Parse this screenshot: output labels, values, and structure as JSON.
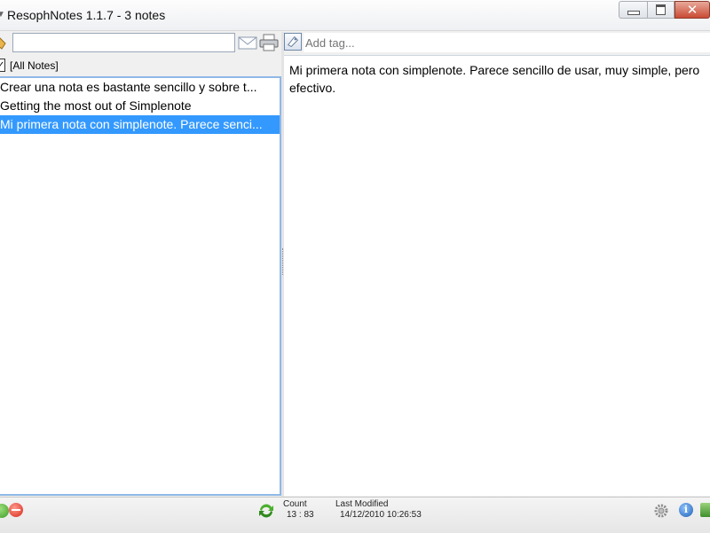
{
  "window": {
    "title": "ResophNotes 1.1.7 - 3 notes",
    "app_icon": "note-icon",
    "controls": [
      "minimize-icon",
      "maximize-icon",
      "close-icon"
    ]
  },
  "left_toolbar": {
    "search_value": "",
    "search_placeholder": "",
    "icons": [
      "tag-search-icon",
      "mail-icon",
      "print-icon"
    ]
  },
  "filter": {
    "label": "[All Notes]"
  },
  "notes": [
    {
      "text": "Crear una nota es bastante sencillo y sobre t..."
    },
    {
      "text": "Getting the most out of Simplenote"
    },
    {
      "text": "Mi primera nota con simplenote. Parece senci...",
      "selected": true
    }
  ],
  "right_toolbar": {
    "tag_placeholder": "Add tag..."
  },
  "editor": {
    "content": "Mi primera nota con simplenote. Parece sencillo de usar, muy simple, pero efectivo."
  },
  "status": {
    "count_label": "Count",
    "count_value": "13 : 83",
    "modified_label": "Last Modified",
    "modified_value": "14/12/2010 10:26:53",
    "icons": [
      "add-note-icon",
      "delete-note-icon",
      "sync-icon",
      "settings-icon",
      "info-icon",
      "plugin-icon"
    ]
  },
  "colors": {
    "selection": "#3399ff",
    "list_border": "#8fb8e6",
    "background": "#f0f0f0"
  }
}
